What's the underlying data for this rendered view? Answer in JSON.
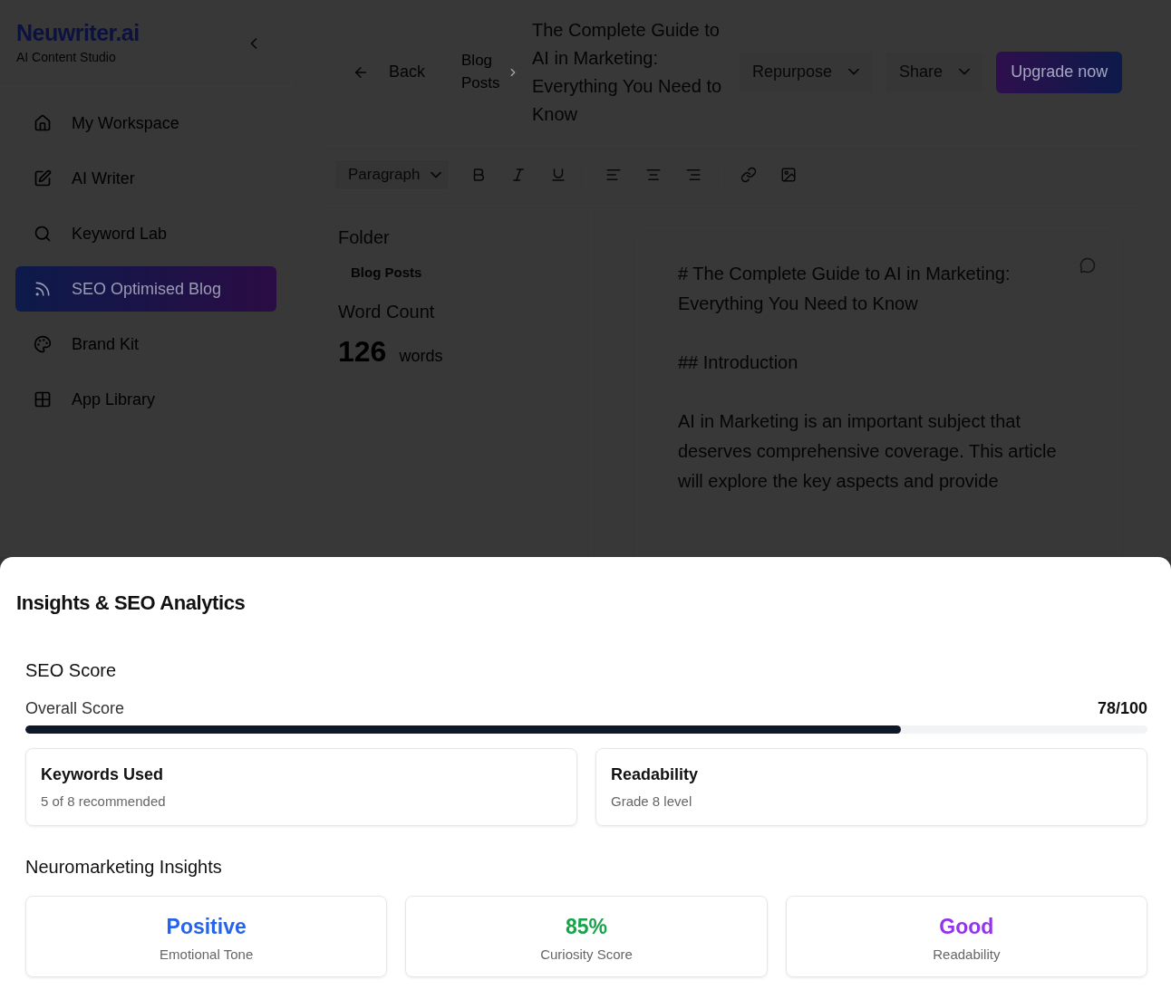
{
  "brand": {
    "name": "Neuwriter.ai",
    "tagline": "AI Content Studio"
  },
  "nav": [
    {
      "label": "My Workspace",
      "selected": false
    },
    {
      "label": "AI Writer",
      "selected": false
    },
    {
      "label": "Keyword Lab",
      "selected": false
    },
    {
      "label": "SEO Optimised Blog",
      "selected": true
    },
    {
      "label": "Brand Kit",
      "selected": false
    },
    {
      "label": "App Library",
      "selected": false
    }
  ],
  "header": {
    "back": "Back",
    "breadcrumb": "Blog Posts",
    "title": "The Complete Guide to AI in Marketing: Everything You Need to Know",
    "menus": [
      "Repurpose",
      "Share"
    ],
    "upgrade": "Upgrade now"
  },
  "toolbar": {
    "block_type": "Paragraph"
  },
  "details": {
    "folder_label": "Folder",
    "folder": "Blog Posts",
    "word_count_label": "Word Count",
    "word_count": "126",
    "word_unit": "words"
  },
  "editor": {
    "paragraphs": [
      "# The Complete Guide to AI in Marketing: Everything You Need to Know",
      "## Introduction",
      "AI in Marketing is an important subject that deserves comprehensive coverage. This article will explore the key aspects and provide"
    ]
  },
  "insights_panel": {
    "title": "Insights & SEO Analytics",
    "seo_title": "SEO Score",
    "overall_label": "Overall Score",
    "overall_score": "78/100",
    "level": 0.78,
    "cards": [
      {
        "title": "Keywords Used",
        "detail": "5 of 8 recommended"
      },
      {
        "title": "Readability",
        "detail": "Grade 8 level"
      }
    ],
    "neuro_title": "Neuromarketing Insights",
    "insights": [
      {
        "value": "Positive",
        "label": "Emotional Tone",
        "color": "#2563eb"
      },
      {
        "value": "85%",
        "label": "Curiosity Score",
        "color": "#16a34a"
      },
      {
        "value": "Good",
        "label": "Readability",
        "color": "#9333ea"
      }
    ]
  }
}
